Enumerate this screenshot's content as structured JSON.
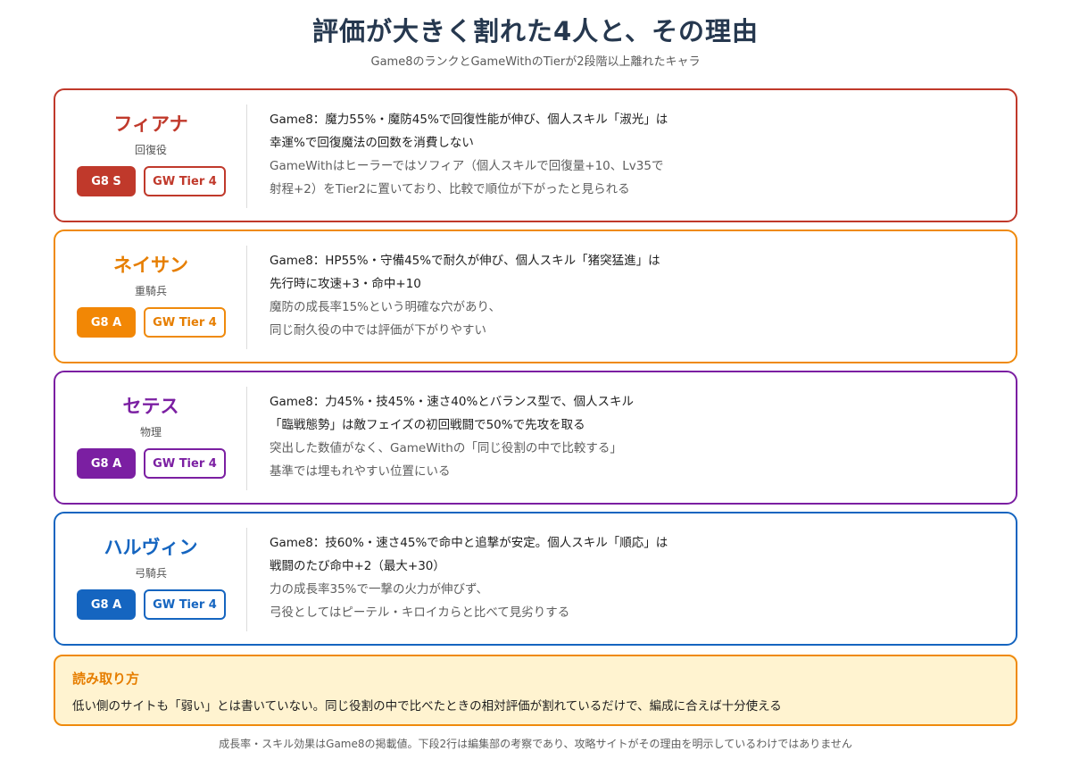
{
  "header": {
    "title": "評価が大きく割れた4人と、その理由",
    "subtitle": "Game8のランクとGameWithのTierが2段階以上離れたキャラ"
  },
  "colors": {
    "red": "#c0392b",
    "orange": "#ef8a0c",
    "purple": "#7b1fa2",
    "blue": "#1565c0",
    "note_bg": "#fff3d0"
  },
  "cards": [
    {
      "name": "フィアナ",
      "role": "回復役",
      "g8": "G8 S",
      "gw": "GW Tier 4",
      "lines": [
        "Game8：魔力55%・魔防45%で回復性能が伸び、個人スキル「淑光」は",
        "幸運%で回復魔法の回数を消費しない",
        "GameWithはヒーラーではソフィア（個人スキルで回復量+10、Lv35で",
        "射程+2）をTier2に置いており、比較で順位が下がったと見られる"
      ]
    },
    {
      "name": "ネイサン",
      "role": "重騎兵",
      "g8": "G8 A",
      "gw": "GW Tier 4",
      "lines": [
        "Game8：HP55%・守備45%で耐久が伸び、個人スキル「猪突猛進」は",
        "先行時に攻速+3・命中+10",
        "魔防の成長率15%という明確な穴があり、",
        "同じ耐久役の中では評価が下がりやすい"
      ]
    },
    {
      "name": "セテス",
      "role": "物理",
      "g8": "G8 A",
      "gw": "GW Tier 4",
      "lines": [
        "Game8：力45%・技45%・速さ40%とバランス型で、個人スキル",
        "「臨戦態勢」は敵フェイズの初回戦闘で50%で先攻を取る",
        "突出した数値がなく、GameWithの「同じ役割の中で比較する」",
        "基準では埋もれやすい位置にいる"
      ]
    },
    {
      "name": "ハルヴィン",
      "role": "弓騎兵",
      "g8": "G8 A",
      "gw": "GW Tier 4",
      "lines": [
        "Game8：技60%・速さ45%で命中と追撃が安定。個人スキル「順応」は",
        "戦闘のたび命中+2（最大+30）",
        "力の成長率35%で一撃の火力が伸びず、",
        "弓役としてはピーテル・キロイカらと比べて見劣りする"
      ]
    }
  ],
  "note": {
    "heading": "読み取り方",
    "body": "低い側のサイトも「弱い」とは書いていない。同じ役割の中で比べたときの相対評価が割れているだけで、編成に合えば十分使える"
  },
  "footer": "成長率・スキル効果はGame8の掲載値。下段2行は編集部の考察であり、攻略サイトがその理由を明示しているわけではありません"
}
